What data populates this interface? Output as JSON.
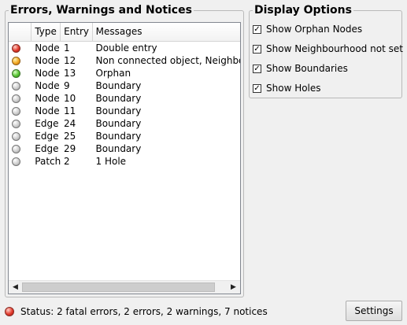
{
  "errors_panel": {
    "title": "Errors, Warnings and Notices",
    "columns": [
      "",
      "Type",
      "Entry",
      "Messages"
    ],
    "rows": [
      {
        "status": "red",
        "type": "Node",
        "entry": "1",
        "message": "Double entry"
      },
      {
        "status": "orange",
        "type": "Node",
        "entry": "12",
        "message": "Non connected object, Neighbourhood not set"
      },
      {
        "status": "green",
        "type": "Node",
        "entry": "13",
        "message": "Orphan"
      },
      {
        "status": "gray",
        "type": "Node",
        "entry": "9",
        "message": "Boundary"
      },
      {
        "status": "gray",
        "type": "Node",
        "entry": "10",
        "message": "Boundary"
      },
      {
        "status": "gray",
        "type": "Node",
        "entry": "11",
        "message": "Boundary"
      },
      {
        "status": "gray",
        "type": "Edge",
        "entry": "24",
        "message": "Boundary"
      },
      {
        "status": "gray",
        "type": "Edge",
        "entry": "25",
        "message": "Boundary"
      },
      {
        "status": "gray",
        "type": "Edge",
        "entry": "29",
        "message": "Boundary"
      },
      {
        "status": "gray",
        "type": "Patch",
        "entry": "2",
        "message": "1 Hole"
      }
    ],
    "scroll_left_icon": "arrow-left-icon",
    "scroll_right_icon": "arrow-right-icon"
  },
  "display_options": {
    "title": "Display Options",
    "items": [
      {
        "label": "Show Orphan Nodes",
        "checked": true
      },
      {
        "label": "Show Neighbourhood not set",
        "checked": true
      },
      {
        "label": "Show Boundaries",
        "checked": true
      },
      {
        "label": "Show Holes",
        "checked": true
      }
    ]
  },
  "status": {
    "indicator": "red",
    "text": "Status:  2 fatal errors, 2 errors, 2 warnings, 7 notices"
  },
  "settings_button": {
    "label": "Settings"
  },
  "colors": {
    "red": "#e23a2c",
    "orange": "#f2a822",
    "green": "#57c432",
    "gray": "#c9c9c9"
  }
}
